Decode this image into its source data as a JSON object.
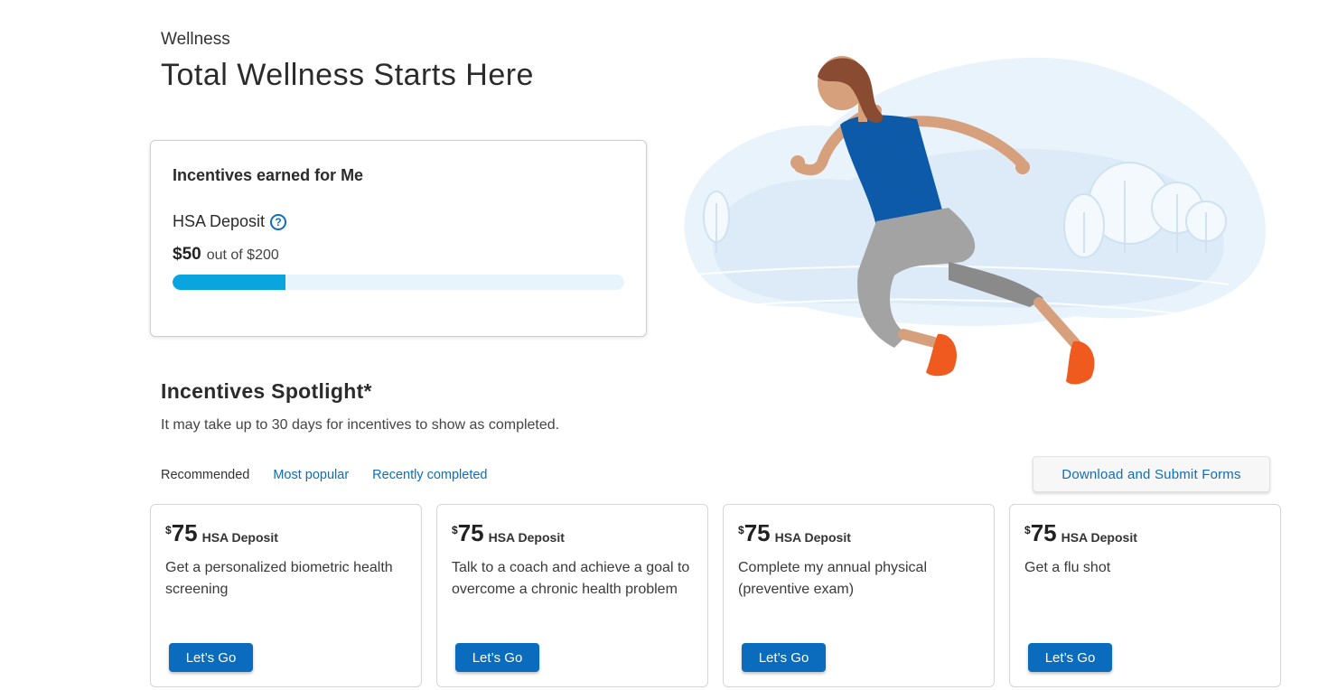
{
  "header": {
    "eyebrow": "Wellness",
    "title": "Total Wellness Starts Here"
  },
  "incentives_card": {
    "title": "Incentives earned for Me",
    "deposit_label": "HSA Deposit",
    "help_icon": "question-circle-icon",
    "earned": "$50",
    "out_of": "out of $200",
    "progress_fraction": 0.25,
    "colors": {
      "fill": "#0aa5df",
      "track": "#e8f4fb"
    }
  },
  "spotlight": {
    "title": "Incentives Spotlight*",
    "note": "It may take up to 30 days for incentives to show as completed.",
    "tabs": [
      {
        "label": "Recommended",
        "active": true
      },
      {
        "label": "Most popular",
        "active": false
      },
      {
        "label": "Recently completed",
        "active": false
      }
    ],
    "forms_button": "Download and Submit Forms",
    "cards": [
      {
        "currency": "$",
        "amount": "75",
        "kind": "HSA Deposit",
        "description": "Get a personalized biometric health screening",
        "button": "Let’s Go"
      },
      {
        "currency": "$",
        "amount": "75",
        "kind": "HSA Deposit",
        "description": "Talk to a coach and achieve a goal to overcome a chronic health problem",
        "button": "Let’s Go"
      },
      {
        "currency": "$",
        "amount": "75",
        "kind": "HSA Deposit",
        "description": "Complete my annual physical (preventive exam)",
        "button": "Let’s Go"
      },
      {
        "currency": "$",
        "amount": "75",
        "kind": "HSA Deposit",
        "description": "Get a flu shot",
        "button": "Let’s Go"
      }
    ]
  },
  "colors": {
    "accent": "#0b6cbd",
    "link": "#0d6ebd"
  }
}
